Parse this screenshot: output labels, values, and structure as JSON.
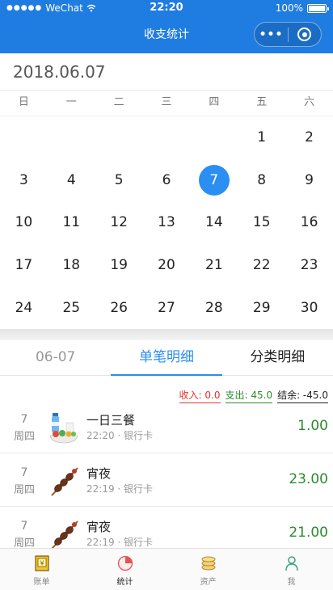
{
  "status_bar": {
    "carrier": "WeChat",
    "signal_dots": "●●●●●",
    "time": "22:20",
    "battery": "100%"
  },
  "nav": {
    "title": "收支统计",
    "more_icon": "•••"
  },
  "calendar": {
    "month_label": "2018.06.07",
    "weekdays": [
      "日",
      "一",
      "二",
      "三",
      "四",
      "五",
      "六"
    ],
    "leading_blanks": 5,
    "days": [
      "1",
      "2",
      "3",
      "4",
      "5",
      "6",
      "7",
      "8",
      "9",
      "10",
      "11",
      "12",
      "13",
      "14",
      "15",
      "16",
      "17",
      "18",
      "19",
      "20",
      "21",
      "22",
      "23",
      "24",
      "25",
      "26",
      "27",
      "28",
      "29",
      "30"
    ],
    "selected_day": "7",
    "accent": "#2a8ef2"
  },
  "tabs": {
    "date": "06-07",
    "single": "单笔明细",
    "category": "分类明细"
  },
  "summary": {
    "income": "收入: 0.0",
    "expense": "支出: 45.0",
    "balance": "结余: -45.0"
  },
  "records": [
    {
      "day": "7",
      "weekday": "周四",
      "name": "一日三餐",
      "meta": "22:20 · 银行卡",
      "amount": "1.00",
      "icon": "meal-icon"
    },
    {
      "day": "7",
      "weekday": "周四",
      "name": "宵夜",
      "meta": "22:19 · 银行卡",
      "amount": "23.00",
      "icon": "skewer-icon"
    },
    {
      "day": "7",
      "weekday": "周四",
      "name": "宵夜",
      "meta": "22:19 · 银行卡",
      "amount": "21.00",
      "icon": "skewer-icon"
    }
  ],
  "bottom_nav": [
    {
      "label": "账单",
      "icon": "ledger-icon"
    },
    {
      "label": "统计",
      "icon": "pie-chart-icon"
    },
    {
      "label": "资产",
      "icon": "coins-icon"
    },
    {
      "label": "我",
      "icon": "person-icon"
    }
  ]
}
